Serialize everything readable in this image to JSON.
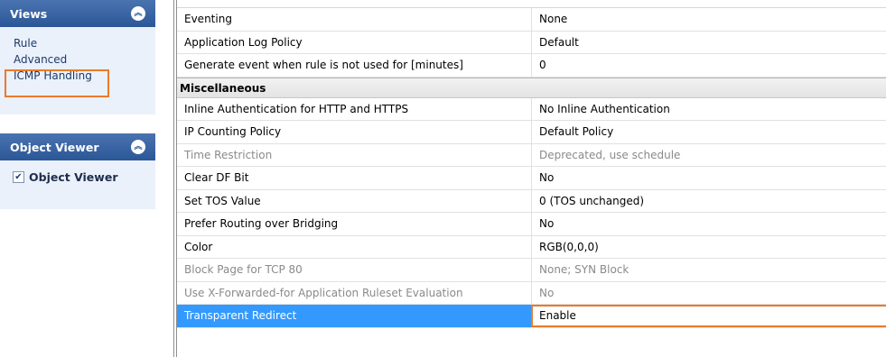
{
  "views_panel": {
    "title": "Views",
    "items": [
      "Rule",
      "Advanced",
      "ICMP Handling"
    ]
  },
  "object_viewer_panel": {
    "title": "Object Viewer",
    "checkbox_label": "Object Viewer",
    "checked": true
  },
  "grid": {
    "rows_top": [
      {
        "name": "Eventing",
        "value": "None"
      },
      {
        "name": "Application Log Policy",
        "value": "Default"
      },
      {
        "name": "Generate event when rule is not used for [minutes]",
        "value": "0"
      }
    ],
    "group_title": "Miscellaneous",
    "rows": [
      {
        "name": "Inline Authentication for HTTP and HTTPS",
        "value": "No Inline Authentication",
        "disabled": false
      },
      {
        "name": "IP Counting Policy",
        "value": "Default Policy",
        "disabled": false
      },
      {
        "name": "Time Restriction",
        "value": "Deprecated, use schedule",
        "disabled": true
      },
      {
        "name": "Clear DF Bit",
        "value": "No",
        "disabled": false
      },
      {
        "name": "Set TOS Value",
        "value": "0 (TOS unchanged)",
        "disabled": false
      },
      {
        "name": "Prefer Routing over Bridging",
        "value": "No",
        "disabled": false
      },
      {
        "name": "Color",
        "value": "RGB(0,0,0)",
        "disabled": false
      },
      {
        "name": "Block Page for TCP 80",
        "value": "None; SYN Block",
        "disabled": true
      },
      {
        "name": "Use X-Forwarded-for Application Ruleset Evaluation",
        "value": "No",
        "disabled": true
      },
      {
        "name": "Transparent Redirect",
        "value": "Enable",
        "disabled": false,
        "selected": true
      }
    ]
  },
  "colors": {
    "panel_header": "#2c5797",
    "highlight": "#ea7a2c",
    "selection": "#3399ff",
    "disabled_text": "#8a8a8a"
  }
}
